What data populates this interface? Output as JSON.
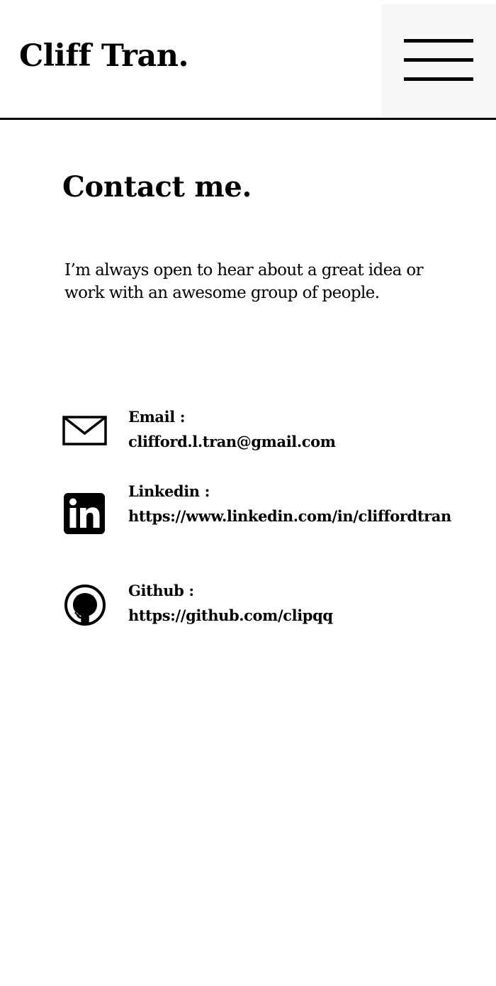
{
  "header": {
    "brand": "Cliff Tran.",
    "menu_icon": "hamburger-menu-icon"
  },
  "main": {
    "title": "Contact me.",
    "intro": "I’m always open to hear about a great idea or work with an awesome group of people.",
    "contacts": [
      {
        "icon": "envelope-icon",
        "label": "Email :",
        "value": "clifford.l.tran@gmail.com"
      },
      {
        "icon": "linkedin-icon",
        "label": "Linkedin :",
        "value": "https://www.linkedin.com/in/cliffordtran"
      },
      {
        "icon": "github-icon",
        "label": "Github :",
        "value": "https://github.com/clipqq"
      }
    ]
  },
  "colors": {
    "text": "#000000",
    "background": "#ffffff",
    "menu_background": "#f7f7f7"
  }
}
